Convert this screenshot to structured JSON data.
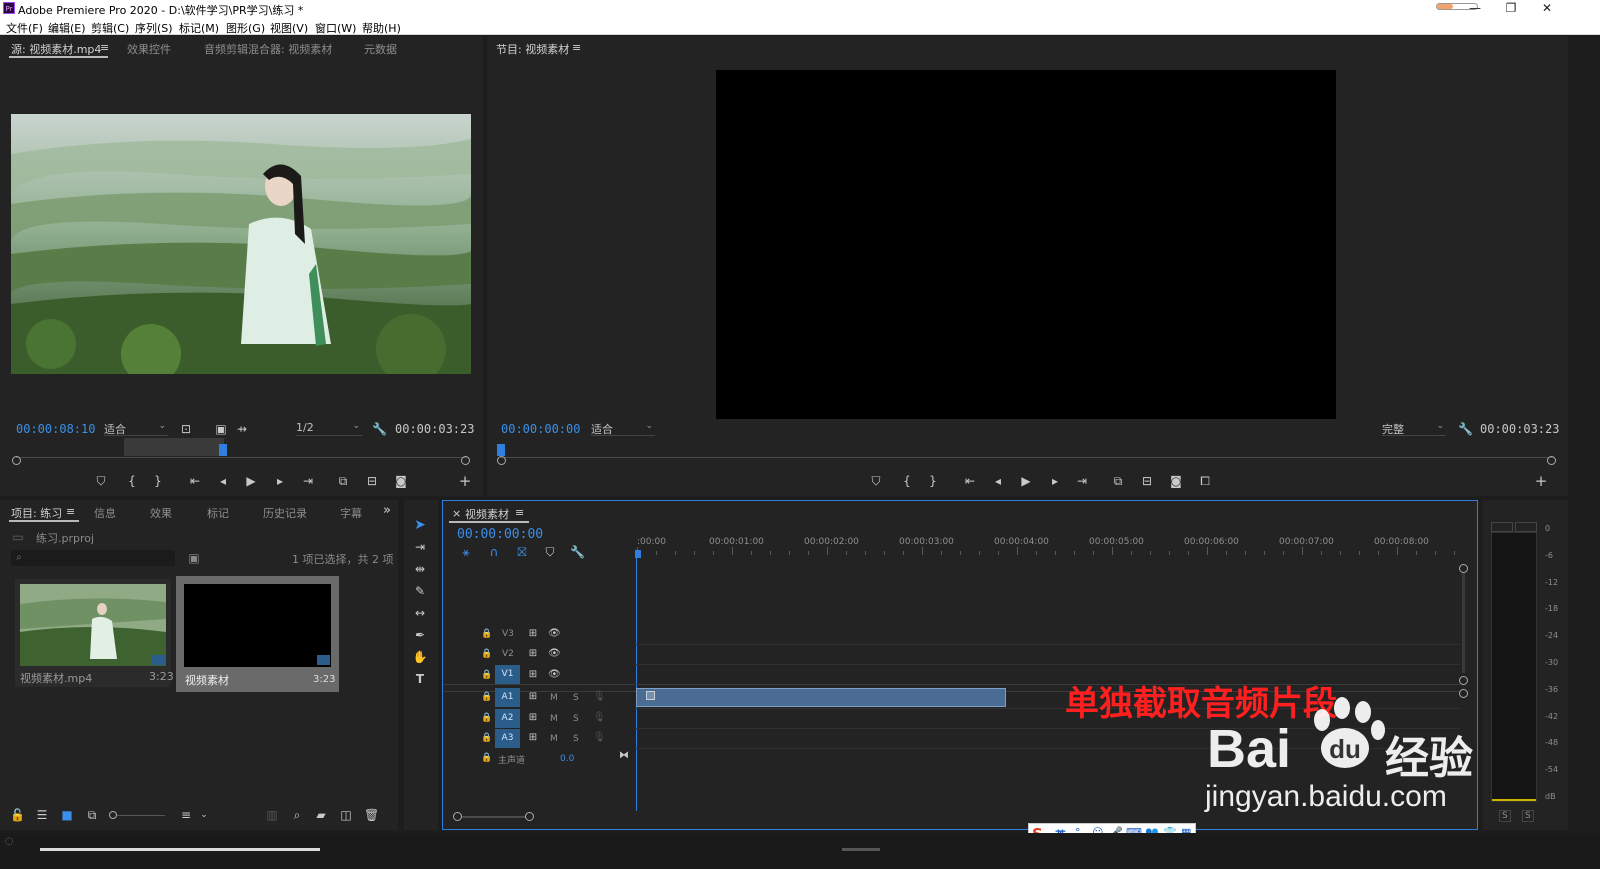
{
  "title_bar": {
    "logo": "Pr",
    "title": "Adobe Premiere Pro 2020 - D:\\软件学习\\PR学习\\练习 *",
    "minimize": "—",
    "restore": "❐",
    "close": "✕"
  },
  "menu": [
    "文件(F)",
    "编辑(E)",
    "剪辑(C)",
    "序列(S)",
    "标记(M)",
    "图形(G)",
    "视图(V)",
    "窗口(W)",
    "帮助(H)"
  ],
  "source_panel": {
    "tabs": [
      "源: 视频素材.mp4",
      "效果控件",
      "音频剪辑混合器: 视频素材",
      "元数据"
    ],
    "menu_icon": "≡",
    "timecode": "00:00:08:10",
    "fit": "适合",
    "resolution": "1/2",
    "duration": "00:00:03:23"
  },
  "program_panel": {
    "tab": "节目: 视频素材",
    "menu_icon": "≡",
    "timecode": "00:00:00:00",
    "fit": "适合",
    "quality": "完整",
    "duration": "00:00:03:23"
  },
  "project_panel": {
    "tabs": [
      "项目: 练习",
      "信息",
      "效果",
      "标记",
      "历史记录",
      "字幕"
    ],
    "more": "»",
    "project_file": "练习.prproj",
    "selection_info": "1 项已选择，共 2 项",
    "items": [
      {
        "name": "视频素材.mp4",
        "duration": "3:23"
      },
      {
        "name": "视频素材",
        "duration": "3:23"
      }
    ]
  },
  "timeline": {
    "close": "×",
    "sequence_name": "视频素材",
    "menu_icon": "≡",
    "timecode": "00:00:00:00",
    "ruler_labels": [
      ":00:00",
      "00:00:01:00",
      "00:00:02:00",
      "00:00:03:00",
      "00:00:04:00",
      "00:00:05:00",
      "00:00:06:00",
      "00:00:07:00",
      "00:00:08:00"
    ],
    "video_tracks": [
      "V3",
      "V2",
      "V1"
    ],
    "audio_tracks": [
      "A1",
      "A2",
      "A3"
    ],
    "mute_label": "M",
    "solo_label": "S",
    "master_label": "主声道",
    "master_value": "0.0"
  },
  "meter": {
    "scale": [
      "0",
      "-6",
      "-12",
      "-18",
      "-24",
      "-30",
      "-36",
      "-42",
      "-48",
      "-54",
      "dB"
    ],
    "solo_buttons": [
      "S",
      "S"
    ]
  },
  "overlay": {
    "caption": "单独截取音频片段",
    "baidu_logo": "Bai",
    "baidu_suffix": "经验",
    "baidu_url": "jingyan.baidu.com"
  },
  "ime_bar": {
    "logo": "S",
    "lang": "英"
  },
  "colors": {
    "accent": "#3c8fe8",
    "caption": "#ff1f1f",
    "panel_bg": "#232323",
    "clip": "#4a6c92"
  }
}
